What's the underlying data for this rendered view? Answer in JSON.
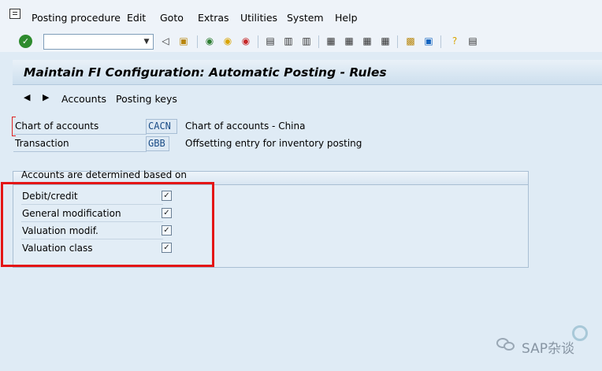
{
  "menubar": {
    "items": [
      "Posting procedure",
      "Edit",
      "Goto",
      "Extras",
      "Utilities",
      "System",
      "Help"
    ]
  },
  "toolbar": {
    "command_field_value": "",
    "icons": [
      "enter-icon",
      "back-icon",
      "save-icon",
      "exit-icon",
      "cancel-icon",
      "print-icon",
      "find-icon",
      "find-next-icon",
      "first-page-icon",
      "prev-page-icon",
      "next-page-icon",
      "last-page-icon",
      "new-session-icon",
      "shortcut-icon",
      "help-icon",
      "layout-icon"
    ]
  },
  "title": "Maintain FI Configuration: Automatic Posting - Rules",
  "app_toolbar": {
    "accounts_label": "Accounts",
    "posting_keys_label": "Posting keys"
  },
  "fields": {
    "chart_of_accounts": {
      "label": "Chart of accounts",
      "value": "CACN",
      "description": "Chart of accounts - China"
    },
    "transaction": {
      "label": "Transaction",
      "value": "GBB",
      "description": "Offsetting entry for inventory posting"
    }
  },
  "group": {
    "title": "Accounts are determined based on",
    "options": [
      {
        "label": "Debit/credit",
        "checked": true
      },
      {
        "label": "General modification",
        "checked": true
      },
      {
        "label": "Valuation modif.",
        "checked": true
      },
      {
        "label": "Valuation class",
        "checked": true
      }
    ]
  },
  "watermark": {
    "text": "SAP杂谈"
  },
  "colors": {
    "highlight": "#e41616",
    "background": "#dfebf5"
  }
}
